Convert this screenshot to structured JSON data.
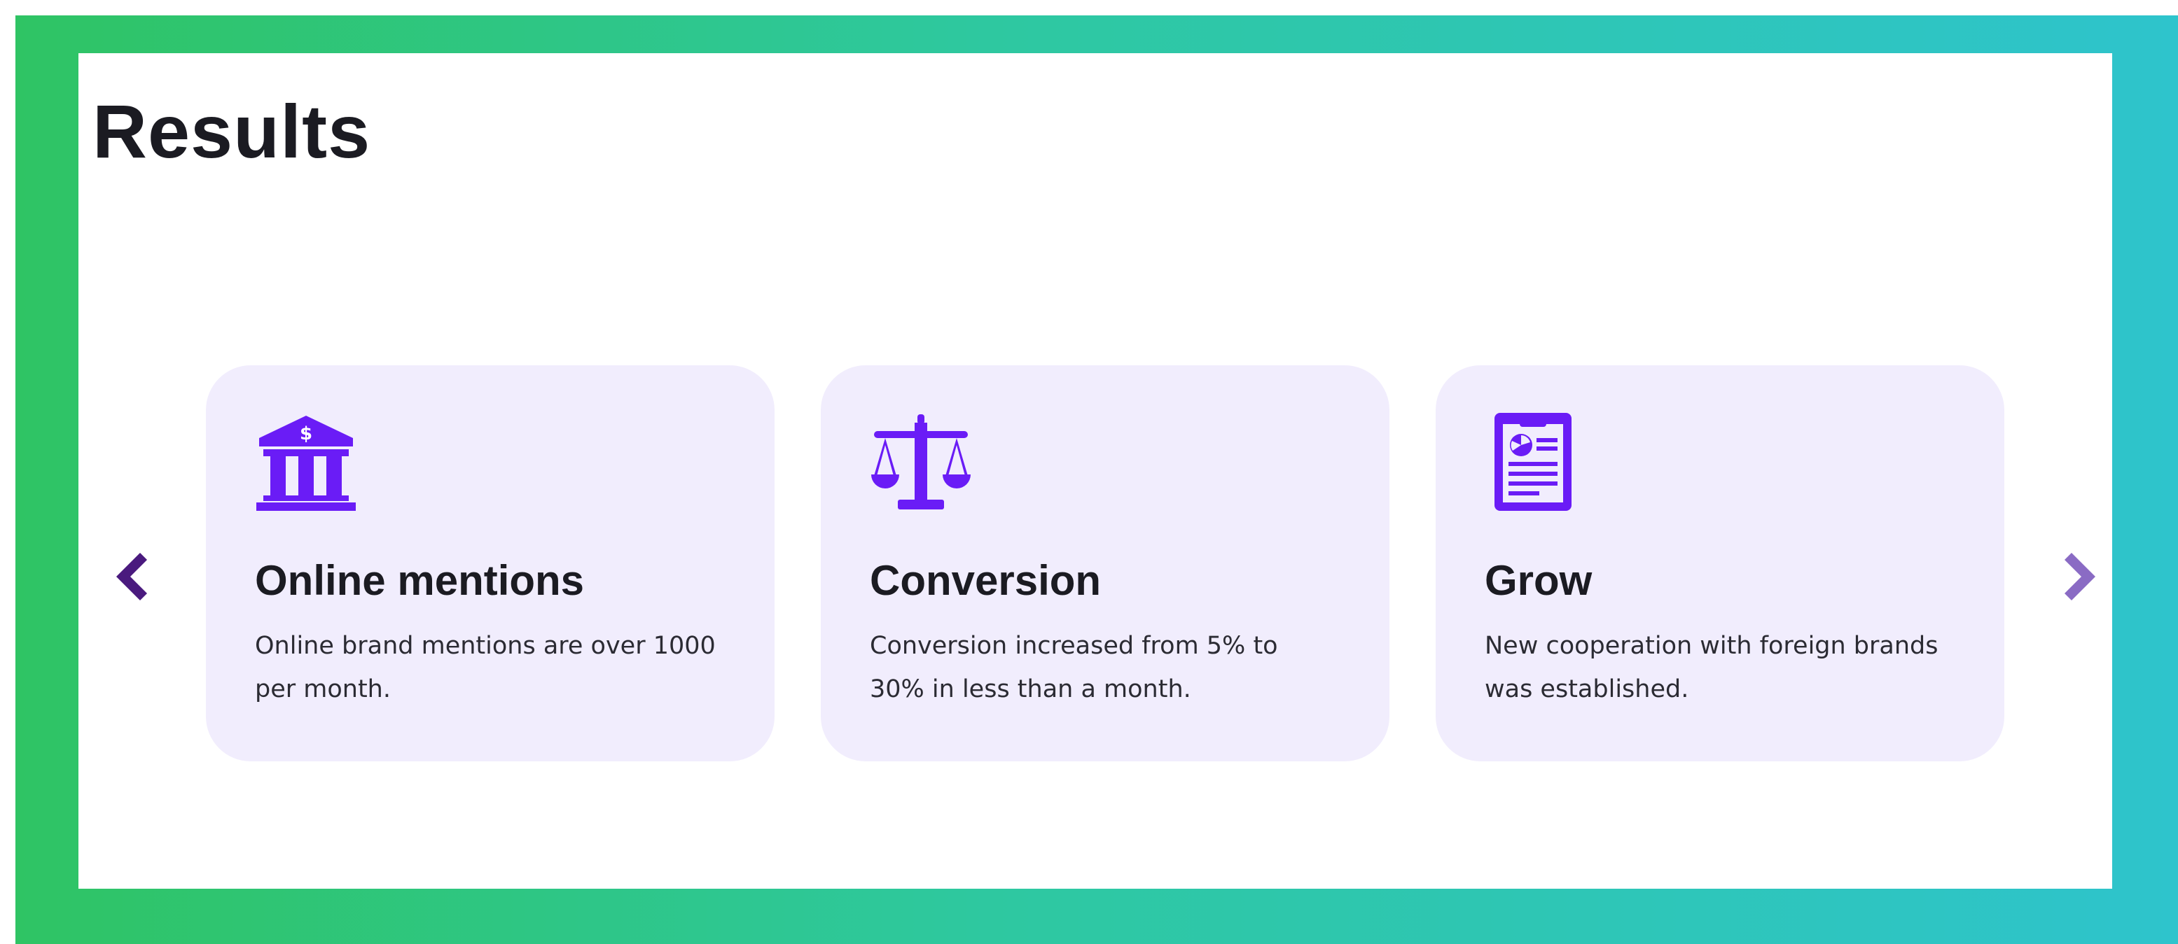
{
  "section": {
    "title": "Results"
  },
  "cards": [
    {
      "icon": "bank-icon",
      "title": "Online mentions",
      "text": "Online brand mentions are over 1000 per month."
    },
    {
      "icon": "scales-icon",
      "title": "Conversion",
      "text": "Conversion increased from 5% to 30% in less than a month."
    },
    {
      "icon": "report-icon",
      "title": "Grow",
      "text": "New cooperation with foreign brands was established."
    }
  ],
  "carousel": {
    "prev_icon": "chevron-left-icon",
    "next_icon": "chevron-right-icon"
  },
  "colors": {
    "accent": "#6a1cf6",
    "card_bg": "#f1edfd",
    "prev_arrow": "#4a1a7e",
    "next_arrow": "#8a6bc4",
    "gradient_start": "#2fc464",
    "gradient_end": "#2ec4cc"
  }
}
